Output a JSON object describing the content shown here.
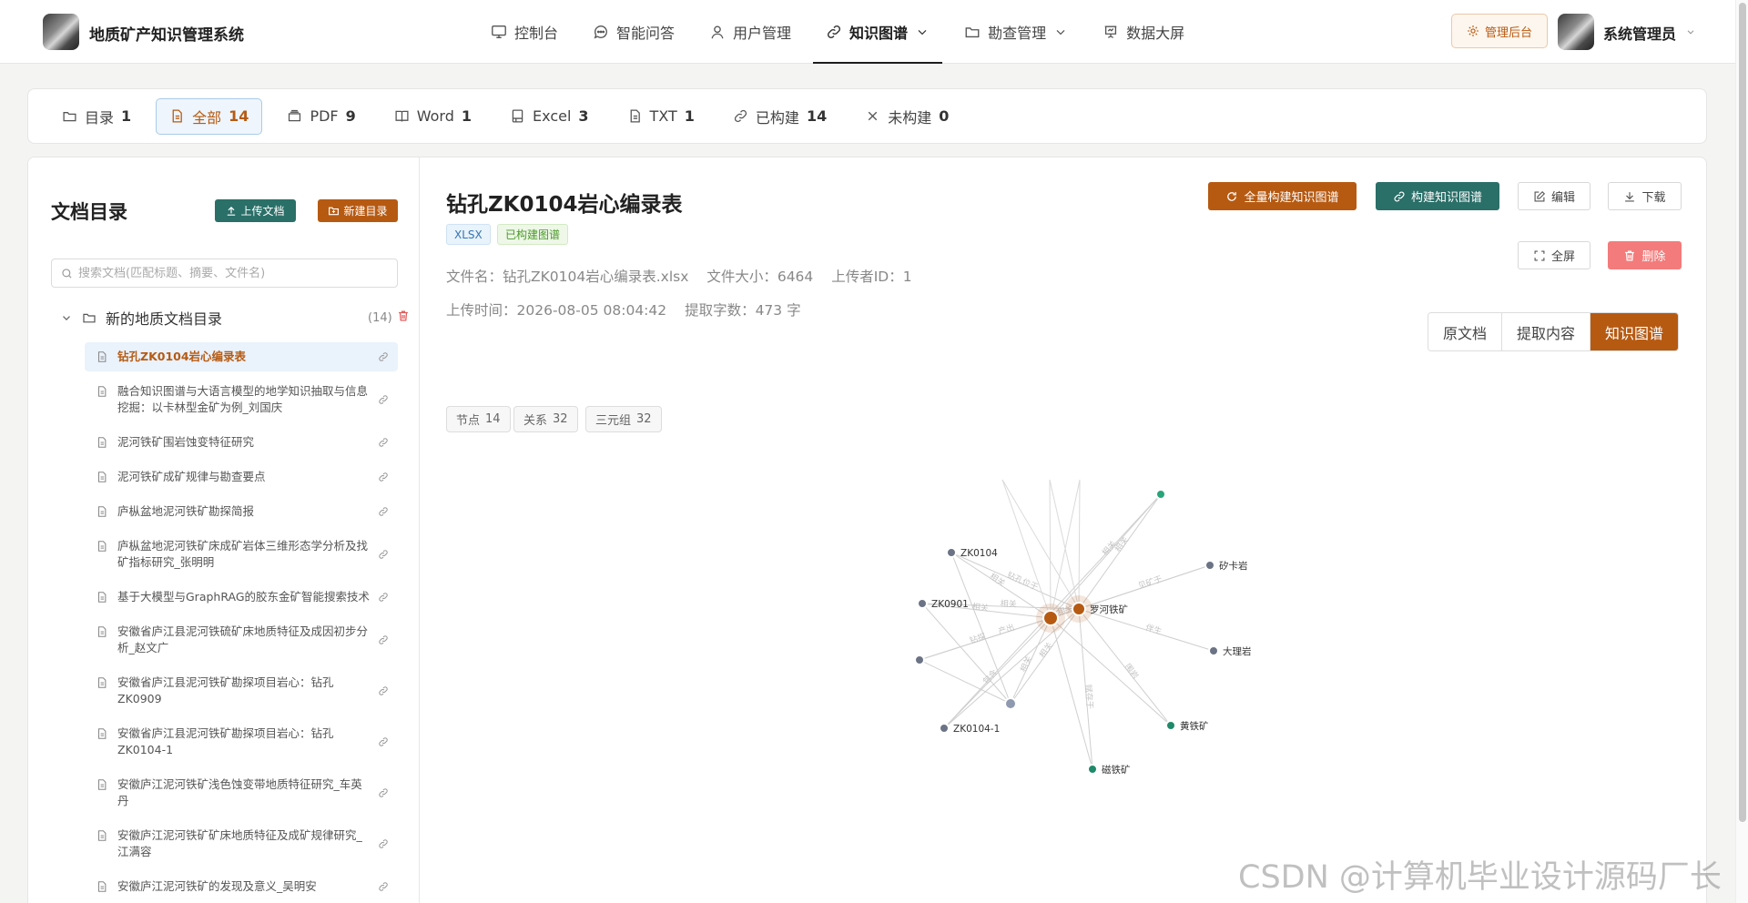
{
  "header": {
    "app_title": "地质矿产知识管理系统",
    "nav": [
      {
        "label": "控制台",
        "icon": "monitor-icon"
      },
      {
        "label": "智能问答",
        "icon": "chat-icon"
      },
      {
        "label": "用户管理",
        "icon": "user-icon"
      },
      {
        "label": "知识图谱",
        "icon": "link-icon",
        "active": true,
        "has_dropdown": true
      },
      {
        "label": "勘查管理",
        "icon": "folder-icon",
        "has_dropdown": true
      },
      {
        "label": "数据大屏",
        "icon": "presentation-icon"
      }
    ],
    "admin_button": "管理后台",
    "user_name": "系统管理员"
  },
  "filters": [
    {
      "label": "目录",
      "count": "1",
      "icon": "folder-icon"
    },
    {
      "label": "全部",
      "count": "14",
      "icon": "file-icon",
      "active": true
    },
    {
      "label": "PDF",
      "count": "9",
      "icon": "stack-icon"
    },
    {
      "label": "Word",
      "count": "1",
      "icon": "book-icon"
    },
    {
      "label": "Excel",
      "count": "3",
      "icon": "sheet-icon"
    },
    {
      "label": "TXT",
      "count": "1",
      "icon": "text-file-icon"
    },
    {
      "label": "已构建",
      "count": "14",
      "icon": "link-icon"
    },
    {
      "label": "未构建",
      "count": "0",
      "icon": "close-icon"
    }
  ],
  "sidebar": {
    "title": "文档目录",
    "upload_button": "上传文档",
    "new_dir_button": "新建目录",
    "search_placeholder": "搜索文档(匹配标题、摘要、文件名)",
    "root": {
      "label": "新的地质文档目录",
      "count": "(14)"
    },
    "docs": [
      {
        "title": "钻孔ZK0104岩心编录表",
        "active": true
      },
      {
        "title": "融合知识图谱与大语言模型的地学知识抽取与信息挖掘：以卡林型金矿为例_刘国庆"
      },
      {
        "title": "泥河铁矿围岩蚀变特征研究"
      },
      {
        "title": "泥河铁矿成矿规律与勘查要点"
      },
      {
        "title": "庐枞盆地泥河铁矿勘探简报"
      },
      {
        "title": "庐枞盆地泥河铁矿床成矿岩体三维形态学分析及找矿指标研究_张明明"
      },
      {
        "title": "基于大模型与GraphRAG的胶东金矿智能搜索技术"
      },
      {
        "title": "安徽省庐江县泥河铁硫矿床地质特征及成因初步分析_赵文广"
      },
      {
        "title": "安徽省庐江县泥河铁矿勘探项目岩心：钻孔ZK0909"
      },
      {
        "title": "安徽省庐江县泥河铁矿勘探项目岩心：钻孔ZK0104-1"
      },
      {
        "title": "安徽庐江泥河铁矿浅色蚀变带地质特征研究_车英丹"
      },
      {
        "title": "安徽庐江泥河铁矿矿床地质特征及成矿规律研究_江满容"
      },
      {
        "title": "安徽庐江泥河铁矿的发现及意义_吴明安"
      }
    ]
  },
  "document": {
    "title": "钻孔ZK0104岩心编录表",
    "ext_tag": "XLSX",
    "status_tag": "已构建图谱",
    "file_name": "文件名：钻孔ZK0104岩心编录表.xlsx",
    "file_size": "文件大小：6464",
    "uploader": "上传者ID：1",
    "upload_time": "上传时间：2026-08-05 08:04:42",
    "char_count": "提取字数：473 字"
  },
  "actions": {
    "full_build": "全量构建知识图谱",
    "build": "构建知识图谱",
    "edit": "编辑",
    "download": "下载",
    "fullscreen": "全屏",
    "delete": "删除"
  },
  "view_tabs": [
    {
      "label": "原文档"
    },
    {
      "label": "提取内容"
    },
    {
      "label": "知识图谱",
      "active": true
    }
  ],
  "graph_stats": [
    {
      "label": "节点",
      "value": "14"
    },
    {
      "label": "关系",
      "value": "32"
    },
    {
      "label": "三元组",
      "value": "32"
    }
  ],
  "graph": {
    "nodes": [
      {
        "id": "zk0104",
        "label": "ZK0104",
        "color": "#6b7385"
      },
      {
        "id": "zk0901",
        "label": "ZK0901",
        "color": "#6b7385"
      },
      {
        "id": "luohe",
        "label": "罗河铁矿",
        "color": "#b65a12"
      },
      {
        "id": "center",
        "label": "",
        "color": "#b65a12"
      },
      {
        "id": "skarn",
        "label": "矽卡岩",
        "color": "#6b7385"
      },
      {
        "id": "marble",
        "label": "大理岩",
        "color": "#6b7385"
      },
      {
        "id": "pyrite",
        "label": "黄铁矿",
        "color": "#1f8a6a"
      },
      {
        "id": "magnetite",
        "label": "磁铁矿",
        "color": "#1f8a6a"
      },
      {
        "id": "zk0104_1",
        "label": "ZK0104-1",
        "color": "#6b7385"
      },
      {
        "id": "leftmid",
        "label": "",
        "color": "#6b7385"
      },
      {
        "id": "lower",
        "label": "",
        "color": "#8f9ab0"
      },
      {
        "id": "top",
        "label": "",
        "color": "#2aa47a"
      }
    ],
    "edge_labels": [
      "相关",
      "相关",
      "钻探",
      "相关",
      "包含",
      "相关",
      "见矿于",
      "伴生",
      "围岩",
      "赋存于",
      "相关",
      "相关",
      "钻孔位于",
      "相关",
      "产出",
      "相关"
    ]
  },
  "watermark": "CSDN @计算机毕业设计源码厂长"
}
